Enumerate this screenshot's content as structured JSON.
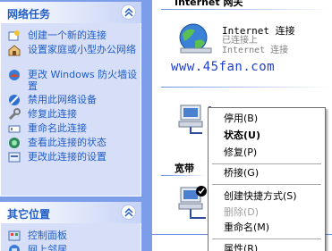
{
  "left_pane": {
    "network_tasks": {
      "title": "网络任务",
      "items": [
        {
          "label": "创建一个新的连接",
          "icon": "new-connection-icon"
        },
        {
          "label": "设置家庭或小型办公网络",
          "icon": "home-network-icon"
        },
        {
          "label": "更改 Windows 防火墙设置",
          "icon": "firewall-icon"
        },
        {
          "label": "禁用此网络设备",
          "icon": "disable-device-icon"
        },
        {
          "label": "修复此连接",
          "icon": "repair-icon"
        },
        {
          "label": "重命名此连接",
          "icon": "rename-icon"
        },
        {
          "label": "查看此连接的状态",
          "icon": "status-icon"
        },
        {
          "label": "更改此连接的设置",
          "icon": "settings-icon"
        }
      ]
    },
    "other_places": {
      "title": "其它位置",
      "items": [
        {
          "label": "控制面板",
          "icon": "control-panel-icon"
        },
        {
          "label": "网上邻居",
          "icon": "network-places-icon"
        }
      ]
    }
  },
  "main": {
    "group_internet": "Internet 网关",
    "connection": {
      "name": "Internet 连接",
      "status": "已连接上",
      "type": "Internet 连接"
    },
    "watermark": "www.45fan.com",
    "group_broadband": "宽带"
  },
  "context_menu": {
    "items": [
      {
        "label": "停用(B)",
        "style": "normal"
      },
      {
        "label": "状态(U)",
        "style": "bold"
      },
      {
        "label": "修复(P)",
        "style": "normal"
      },
      {
        "label": "桥接(G)",
        "style": "normal"
      },
      {
        "label": "创建快捷方式(S)",
        "style": "normal"
      },
      {
        "label": "删除(D)",
        "style": "disabled"
      },
      {
        "label": "重命名(M)",
        "style": "normal"
      },
      {
        "label": "属性(R)",
        "style": "normal"
      }
    ]
  },
  "colors": {
    "task_link": "#215dc6",
    "pane_background": "#7c9ee8",
    "panel_background": "#d6dff7",
    "watermark": "#1f3fcc"
  }
}
